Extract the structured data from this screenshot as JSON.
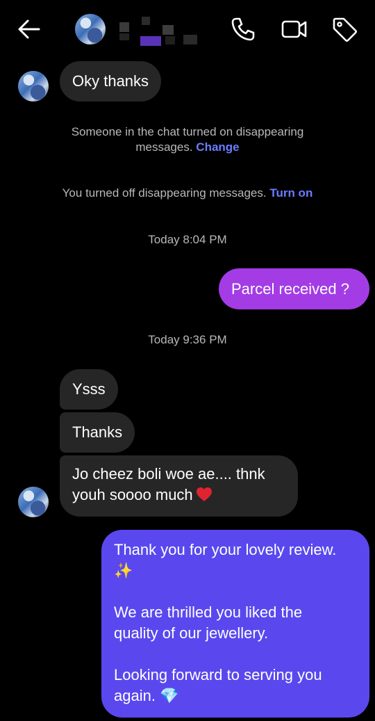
{
  "messages": {
    "m1": "Oky thanks",
    "sys1_line1": "Someone in the chat turned on disappearing",
    "sys1_line2": "messages.",
    "sys1_link": "Change",
    "sys2_text": "You turned off disappearing messages.",
    "sys2_link": "Turn on",
    "ts1": "Today 8:04 PM",
    "m2": "Parcel received ?",
    "ts2": "Today 9:36 PM",
    "m3": "Ysss",
    "m4": "Thanks",
    "m5_line1": "Jo cheez boli woe ae.... thnk",
    "m5_line2": "youh soooo much",
    "m6_l1": "Thank you for your lovely review.",
    "m6_l2": "✨",
    "m6_l3": "We are thrilled you liked the",
    "m6_l4": "quality of our jewellery.",
    "m6_l5": "Looking forward to serving you",
    "m6_l6": "again.",
    "m6_l6_emoji": "💎"
  },
  "icons": [
    "back-arrow-icon",
    "phone-icon",
    "video-camera-icon",
    "tag-icon",
    "heart-emoji-icon"
  ],
  "colors": {
    "background": "#000000",
    "received_bubble": "#262626",
    "sent_bubble_purple": "#a43ce6",
    "sent_bubble_blue": "#5a48ee",
    "link": "#6a7cff",
    "system_text": "#b8b8b8"
  }
}
